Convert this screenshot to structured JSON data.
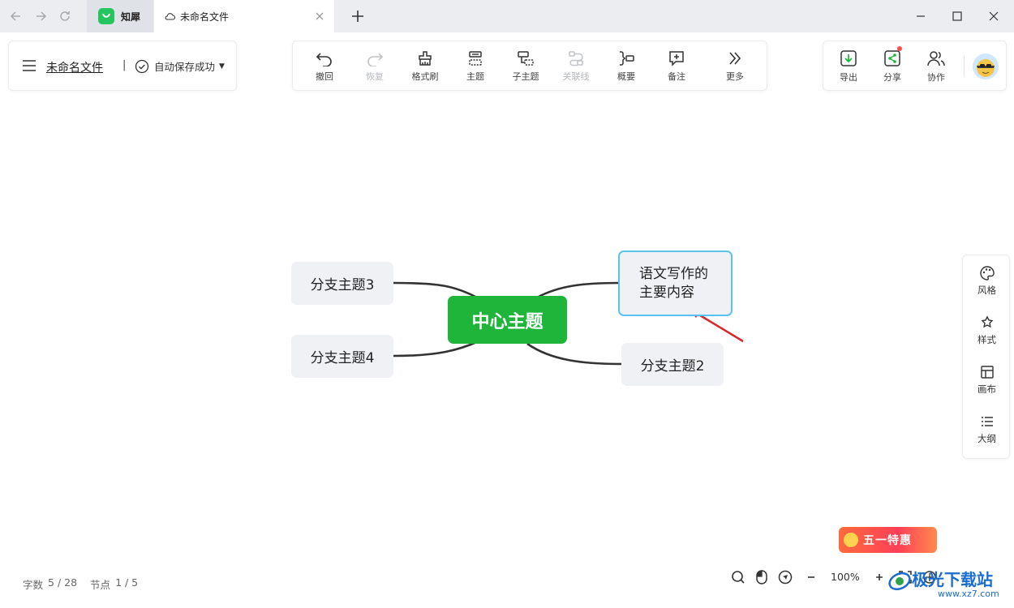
{
  "browser": {
    "app_tab_label": "知犀",
    "file_tab_label": "未命名文件"
  },
  "file_panel": {
    "file_name": "未命名文件",
    "separator": "|",
    "save_status": "自动保存成功"
  },
  "toolbar": {
    "items": [
      {
        "label": "撤回",
        "icon": "undo-icon",
        "enabled": true
      },
      {
        "label": "恢复",
        "icon": "redo-icon",
        "enabled": false
      },
      {
        "label": "格式刷",
        "icon": "format-brush-icon",
        "enabled": true
      },
      {
        "label": "主题",
        "icon": "topic-icon",
        "enabled": true
      },
      {
        "label": "子主题",
        "icon": "subtopic-icon",
        "enabled": true
      },
      {
        "label": "关联线",
        "icon": "relation-line-icon",
        "enabled": false
      },
      {
        "label": "概要",
        "icon": "summary-icon",
        "enabled": true
      },
      {
        "label": "备注",
        "icon": "note-icon",
        "enabled": true
      },
      {
        "label": "更多",
        "icon": "more-icon",
        "enabled": true
      }
    ]
  },
  "right_panel": {
    "export_label": "导出",
    "share_label": "分享",
    "collab_label": "协作"
  },
  "side_panel": {
    "items": [
      {
        "label": "风格",
        "icon": "palette-icon"
      },
      {
        "label": "样式",
        "icon": "style-icon"
      },
      {
        "label": "画布",
        "icon": "canvas-icon"
      },
      {
        "label": "大纲",
        "icon": "outline-icon"
      }
    ]
  },
  "mindmap": {
    "center": "中心主题",
    "branch1_line1": "语文写作的",
    "branch1_line2": "主要内容",
    "branch2": "分支主题2",
    "branch3": "分支主题3",
    "branch4": "分支主题4"
  },
  "status_bar": {
    "word_label": "字数",
    "word_count": "5 / 28",
    "node_label": "节点",
    "node_count": "1 / 5",
    "zoom": "100%"
  },
  "promo": {
    "label": "五一特惠"
  },
  "watermark": {
    "title": "极光下载站",
    "url": "www.xz7.com"
  },
  "colors": {
    "center_node": "#1eb53a",
    "selected_border": "#5bc3f2",
    "branch_node": "#eff1f4",
    "arrow": "#d9262c"
  }
}
